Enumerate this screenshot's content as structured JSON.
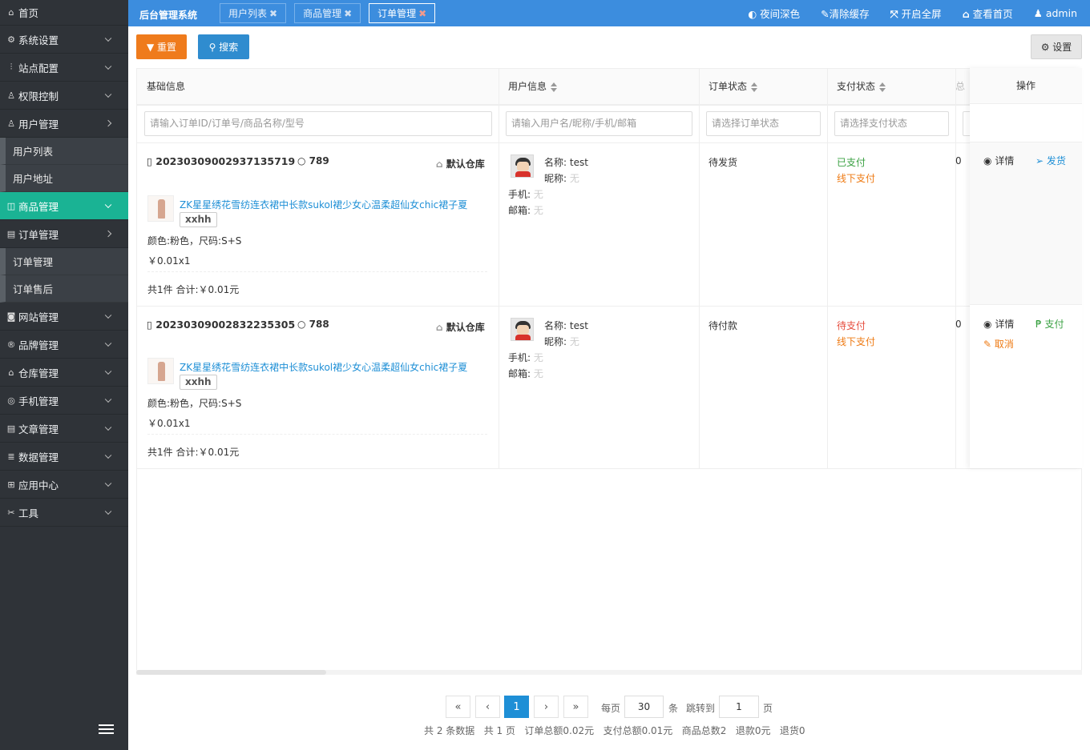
{
  "sidebar": {
    "home": "首页",
    "items": [
      {
        "label": "系统设置",
        "icon": "gear-icon"
      },
      {
        "label": "站点配置",
        "icon": "sliders-icon"
      },
      {
        "label": "权限控制",
        "icon": "user-lock-icon"
      },
      {
        "label": "用户管理",
        "icon": "users-icon"
      },
      {
        "label": "用户列表"
      },
      {
        "label": "用户地址"
      },
      {
        "label": "商品管理",
        "icon": "cart-icon"
      },
      {
        "label": "订单管理",
        "icon": "order-icon"
      },
      {
        "label": "订单管理"
      },
      {
        "label": "订单售后"
      },
      {
        "label": "网站管理",
        "icon": "chat-icon"
      },
      {
        "label": "品牌管理",
        "icon": "registered-icon"
      },
      {
        "label": "仓库管理",
        "icon": "warehouse-icon"
      },
      {
        "label": "手机管理",
        "icon": "phone-icon"
      },
      {
        "label": "文章管理",
        "icon": "article-icon"
      },
      {
        "label": "数据管理",
        "icon": "database-icon"
      },
      {
        "label": "应用中心",
        "icon": "apps-icon"
      },
      {
        "label": "工具",
        "icon": "tools-icon"
      }
    ]
  },
  "topbar": {
    "brand": "后台管理系统",
    "tabs": [
      "用户列表",
      "商品管理",
      "订单管理"
    ],
    "actions": [
      "夜间深色",
      "清除缓存",
      "开启全屏",
      "查看首页",
      "admin"
    ]
  },
  "toolbar": {
    "reset": "重置",
    "search": "搜索",
    "settings": "设置"
  },
  "table": {
    "headers": [
      "基础信息",
      "用户信息",
      "订单状态",
      "支付状态",
      "操作"
    ],
    "filters": {
      "basic": "请输入订单ID/订单号/商品名称/型号",
      "user": "请输入用户名/昵称/手机/邮箱",
      "order_status": "请选择订单状态",
      "pay_status": "请选择支付状态"
    },
    "rows": [
      {
        "order_no": "20230309002937135719",
        "id": "789",
        "warehouse": "默认仓库",
        "product": "ZK星星绣花雪纺连衣裙中长款sukol裙少女心温柔超仙女chic裙子夏",
        "model": "xxhh",
        "spec": "颜色:粉色，尺码:S+S",
        "price": "￥0.01x1",
        "summary": "共1件 合计:￥0.01元",
        "user_name_label": "名称:",
        "user_name": "test",
        "nickname_label": "昵称:",
        "nickname": "无",
        "phone_label": "手机:",
        "phone": "无",
        "email_label": "邮箱:",
        "email": "无",
        "order_status": "待发货",
        "pay_status": "已支付",
        "pay_method": "线下支付",
        "extra": "0",
        "ops": [
          "详情",
          "发货"
        ]
      },
      {
        "order_no": "20230309002832235305",
        "id": "788",
        "warehouse": "默认仓库",
        "product": "ZK星星绣花雪纺连衣裙中长款sukol裙少女心温柔超仙女chic裙子夏",
        "model": "xxhh",
        "spec": "颜色:粉色，尺码:S+S",
        "price": "￥0.01x1",
        "summary": "共1件 合计:￥0.01元",
        "user_name_label": "名称:",
        "user_name": "test",
        "nickname_label": "昵称:",
        "nickname": "无",
        "phone_label": "手机:",
        "phone": "无",
        "email_label": "邮箱:",
        "email": "无",
        "order_status": "待付款",
        "pay_status": "待支付",
        "pay_method": "线下支付",
        "extra": "0",
        "ops": [
          "详情",
          "支付",
          "取消"
        ]
      }
    ]
  },
  "pagination": {
    "first": "«",
    "prev": "‹",
    "current": "1",
    "next": "›",
    "last": "»",
    "per_page_label": "每页",
    "per_page": "30",
    "per_page_unit": "条",
    "jump_label": "跳转到",
    "jump_page": "1",
    "page_unit": "页",
    "summary": "共 2 条数据   共 1 页   订单总额0.02元   支付总额0.01元   商品总数2   退款0元   退货0"
  }
}
